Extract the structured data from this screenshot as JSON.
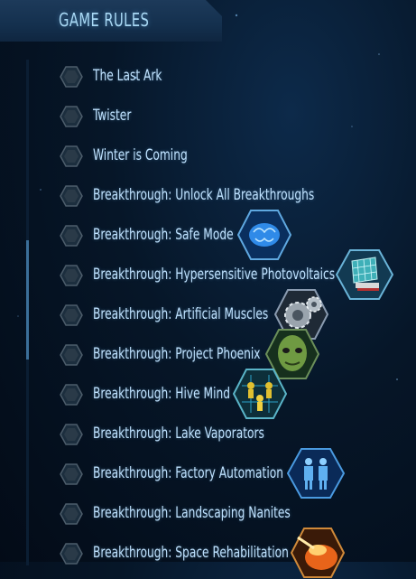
{
  "header": {
    "title": "GAME RULES"
  },
  "rules": [
    {
      "label": "The Last Ark",
      "checked": false,
      "icon": null
    },
    {
      "label": "Twister",
      "checked": false,
      "icon": null
    },
    {
      "label": "Winter is Coming",
      "checked": false,
      "icon": null
    },
    {
      "label": "Breakthrough: Unlock All Breakthroughs",
      "checked": false,
      "icon": null
    },
    {
      "label": "Breakthrough: Safe Mode",
      "checked": false,
      "icon": "brain-icon"
    },
    {
      "label": "Breakthrough: Hypersensitive Photovoltaics",
      "checked": false,
      "icon": "solar-panel-icon"
    },
    {
      "label": "Breakthrough: Artificial Muscles",
      "checked": false,
      "icon": "gears-icon"
    },
    {
      "label": "Breakthrough: Project Phoenix",
      "checked": false,
      "icon": "alien-head-icon"
    },
    {
      "label": "Breakthrough: Hive Mind",
      "checked": false,
      "icon": "hive-mind-icon"
    },
    {
      "label": "Breakthrough: Lake Vaporators",
      "checked": false,
      "icon": null
    },
    {
      "label": "Breakthrough: Factory Automation",
      "checked": false,
      "icon": "robots-icon"
    },
    {
      "label": "Breakthrough: Landscaping Nanites",
      "checked": false,
      "icon": null
    },
    {
      "label": "Breakthrough: Space Rehabilitation",
      "checked": false,
      "icon": "meteor-icon"
    }
  ]
}
